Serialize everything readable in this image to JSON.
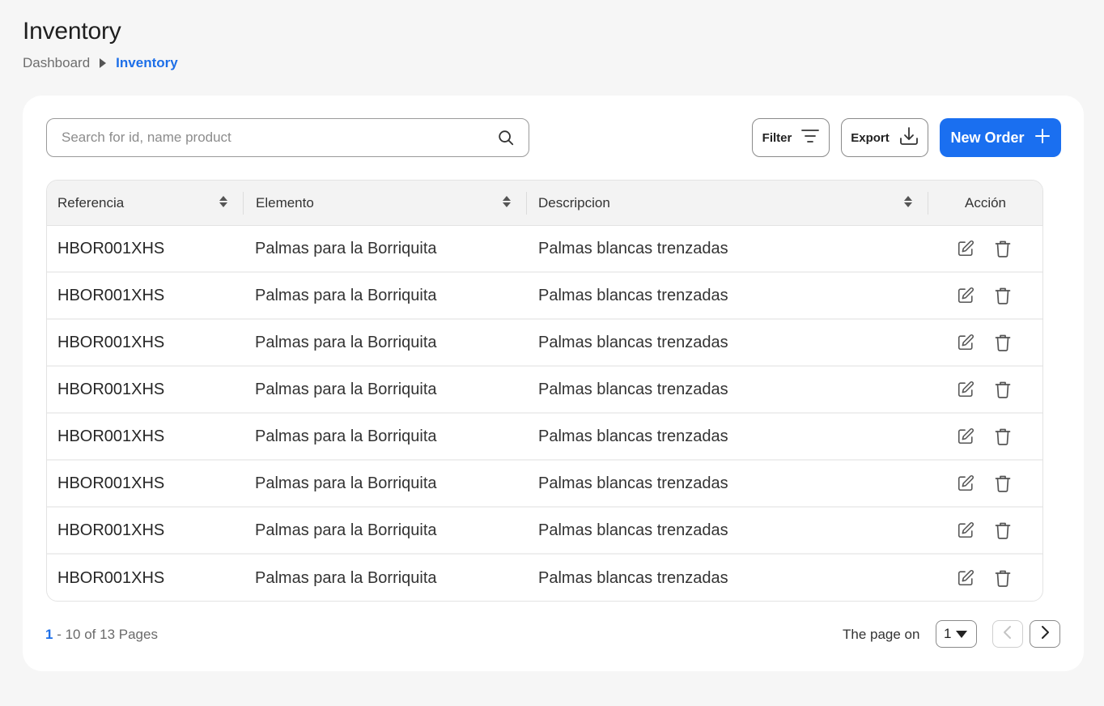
{
  "page": {
    "title": "Inventory"
  },
  "breadcrumb": {
    "items": [
      "Dashboard",
      "Inventory"
    ]
  },
  "search": {
    "placeholder": "Search for id, name product",
    "value": ""
  },
  "toolbar": {
    "filter_label": "Filter",
    "export_label": "Export",
    "new_order_label": "New Order"
  },
  "table": {
    "headers": [
      "Referencia",
      "Elemento",
      "Descripcion",
      "Acción"
    ],
    "rows": [
      {
        "ref": "HBOR001XHS",
        "element": "Palmas para la Borriquita",
        "description": "Palmas blancas trenzadas"
      },
      {
        "ref": "HBOR001XHS",
        "element": "Palmas para la Borriquita",
        "description": "Palmas blancas trenzadas"
      },
      {
        "ref": "HBOR001XHS",
        "element": "Palmas para la Borriquita",
        "description": "Palmas blancas trenzadas"
      },
      {
        "ref": "HBOR001XHS",
        "element": "Palmas para la Borriquita",
        "description": "Palmas blancas trenzadas"
      },
      {
        "ref": "HBOR001XHS",
        "element": "Palmas para la Borriquita",
        "description": "Palmas blancas trenzadas"
      },
      {
        "ref": "HBOR001XHS",
        "element": "Palmas para la Borriquita",
        "description": "Palmas blancas trenzadas"
      },
      {
        "ref": "HBOR001XHS",
        "element": "Palmas para la Borriquita",
        "description": "Palmas blancas trenzadas"
      },
      {
        "ref": "HBOR001XHS",
        "element": "Palmas para la Borriquita",
        "description": "Palmas blancas trenzadas"
      }
    ],
    "row_actions": [
      "edit-icon",
      "trash-icon"
    ]
  },
  "pagination": {
    "current": "1",
    "range_text": " - 10 of 13 Pages",
    "page_on_label": "The page on",
    "selected_page": "1"
  },
  "icons": {
    "search": "search-icon",
    "filter": "filter-icon",
    "export": "download-icon",
    "new_order": "plus-icon",
    "sort": "sort-icon",
    "prev": "chevron-left-icon",
    "next": "chevron-right-icon"
  },
  "colors": {
    "accent": "#1a6ff0",
    "background": "#f6f6f6",
    "card": "#ffffff"
  }
}
